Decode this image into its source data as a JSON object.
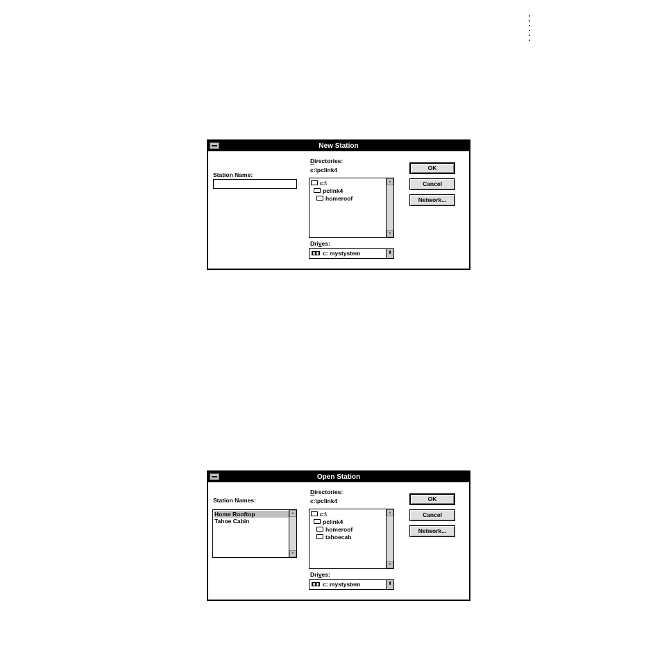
{
  "dialog_new": {
    "title": "New Station",
    "station_name_label": "Station Name:",
    "station_name_value": "",
    "directories_label": "Directories:",
    "current_path": "c:\\pclink4",
    "tree": [
      "c:\\",
      "pclink4",
      "homeroof"
    ],
    "drives_label": "Drives:",
    "drive_value": "c: mystystem",
    "ok_label": "OK",
    "cancel_label": "Cancel",
    "network_label": "Network..."
  },
  "dialog_open": {
    "title": "Open Station",
    "station_names_label": "Station Names:",
    "station_names": [
      "Home Rooftop",
      "Tahoe Cabin"
    ],
    "directories_label": "Directories:",
    "current_path": "c:\\pclink4",
    "tree": [
      "c:\\",
      "pclink4",
      "homeroof",
      "tahoecab"
    ],
    "drives_label": "Drives:",
    "drive_value": "c: mystystem",
    "ok_label": "OK",
    "cancel_label": "Cancel",
    "network_label": "Network..."
  },
  "icons": {
    "folder": "folder-icon",
    "drive": "drive-icon",
    "system_menu": "system-menu-icon"
  }
}
